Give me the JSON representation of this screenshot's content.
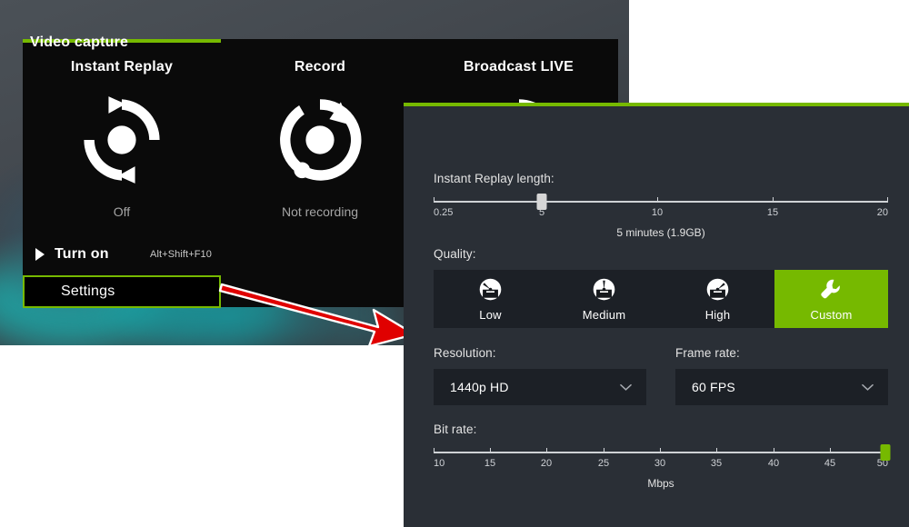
{
  "theme": {
    "nvidia_green": "#76b900",
    "panel_bg": "#2a2f36",
    "overlay_bg": "#0a0a0a",
    "control_bg": "#1c2026",
    "arrow_color": "#e00000"
  },
  "overlay": {
    "tiles": [
      {
        "title": "Instant Replay",
        "status": "Off",
        "icon": "instant-replay-icon"
      },
      {
        "title": "Record",
        "status": "Not recording",
        "icon": "record-icon"
      },
      {
        "title": "Broadcast LIVE",
        "status": "",
        "icon": "broadcast-icon"
      }
    ],
    "turn_on": {
      "label": "Turn on",
      "hotkey": "Alt+Shift+F10",
      "icon": "play-icon"
    },
    "settings": {
      "label": "Settings"
    }
  },
  "panel": {
    "title": "Video capture",
    "instant_replay": {
      "label": "Instant Replay length:",
      "caption": "5 minutes (1.9GB)",
      "value": 5,
      "min": 0.25,
      "max": 20,
      "ticks": [
        {
          "label": "0.25",
          "pos": 0
        },
        {
          "label": "5",
          "pos": 23.8
        },
        {
          "label": "10",
          "pos": 49.2
        },
        {
          "label": "15",
          "pos": 74.6
        },
        {
          "label": "20",
          "pos": 100
        }
      ]
    },
    "quality": {
      "label": "Quality:",
      "selected": "Custom",
      "options": [
        {
          "label": "Low",
          "icon": "gauge-low-icon",
          "selected": false
        },
        {
          "label": "Medium",
          "icon": "gauge-medium-icon",
          "selected": false
        },
        {
          "label": "High",
          "icon": "gauge-high-icon",
          "selected": false
        },
        {
          "label": "Custom",
          "icon": "wrench-icon",
          "selected": true
        }
      ]
    },
    "resolution": {
      "label": "Resolution:",
      "value": "1440p HD",
      "chevron": "chevron-down-icon"
    },
    "frame_rate": {
      "label": "Frame rate:",
      "value": "60 FPS",
      "chevron": "chevron-down-icon"
    },
    "bit_rate": {
      "label": "Bit rate:",
      "caption": "Mbps",
      "value": 50,
      "min": 10,
      "max": 50,
      "ticks": [
        {
          "label": "10",
          "pos": 0
        },
        {
          "label": "15",
          "pos": 12.5
        },
        {
          "label": "20",
          "pos": 25
        },
        {
          "label": "25",
          "pos": 37.5
        },
        {
          "label": "30",
          "pos": 50
        },
        {
          "label": "35",
          "pos": 62.5
        },
        {
          "label": "40",
          "pos": 75
        },
        {
          "label": "45",
          "pos": 87.5
        },
        {
          "label": "50",
          "pos": 100
        }
      ]
    }
  }
}
